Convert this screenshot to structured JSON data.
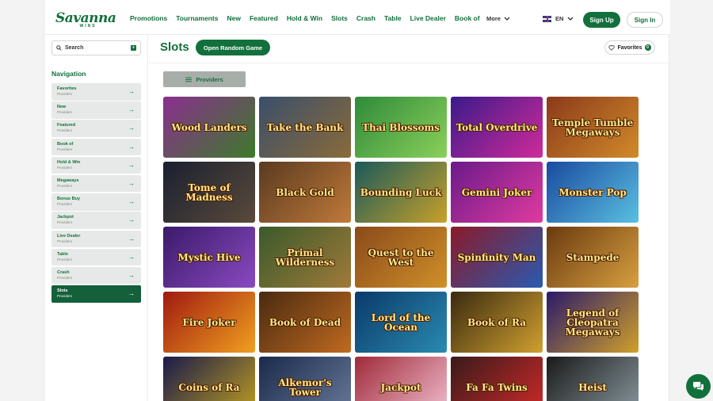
{
  "header": {
    "logo_word": "Savanna",
    "logo_sub": "WINS",
    "nav": [
      "Promotions",
      "Tournaments",
      "New",
      "Featured",
      "Hold & Win",
      "Slots",
      "Crash",
      "Table",
      "Live Dealer",
      "Book of"
    ],
    "more_label": "More",
    "lang_label": "EN",
    "signup_label": "Sign Up",
    "signin_label": "Sign In"
  },
  "sidebar": {
    "search_placeholder": "Search",
    "nav_title": "Navigation",
    "items": [
      {
        "label": "Favorites",
        "sub": "Providers"
      },
      {
        "label": "New",
        "sub": "Providers"
      },
      {
        "label": "Featured",
        "sub": "Providers"
      },
      {
        "label": "Book of",
        "sub": "Providers"
      },
      {
        "label": "Hold & Win",
        "sub": "Providers"
      },
      {
        "label": "Megaways",
        "sub": "Providers"
      },
      {
        "label": "Bonus Buy",
        "sub": "Providers"
      },
      {
        "label": "Jackpot",
        "sub": "Providers"
      },
      {
        "label": "Live Dealer",
        "sub": "Providers"
      },
      {
        "label": "Table",
        "sub": "Providers"
      },
      {
        "label": "Crash",
        "sub": "Providers"
      },
      {
        "label": "Slots",
        "sub": "Providers"
      }
    ],
    "active_item": "Slots"
  },
  "main": {
    "title": "Slots",
    "random_label": "Open Random Game",
    "favorites_label": "Favorites",
    "favorites_count": "0",
    "providers_label": "Providers",
    "games": [
      {
        "name": "Wood Landers",
        "colors": [
          "#8a2f8f",
          "#3d7a2a"
        ]
      },
      {
        "name": "Take the Bank",
        "colors": [
          "#3a4f6a",
          "#8a6a3a"
        ]
      },
      {
        "name": "Thai Blossoms",
        "colors": [
          "#2f8a3a",
          "#8ad05a"
        ]
      },
      {
        "name": "Total Overdrive",
        "colors": [
          "#3b1a8a",
          "#d02a9a"
        ]
      },
      {
        "name": "Temple Tumble Megaways",
        "colors": [
          "#8a3a1a",
          "#d28a2a"
        ]
      },
      {
        "name": "Tome of Madness",
        "colors": [
          "#1a2030",
          "#5a4a3a"
        ]
      },
      {
        "name": "Black Gold",
        "colors": [
          "#5a3a20",
          "#c07a3a"
        ]
      },
      {
        "name": "Bounding Luck",
        "colors": [
          "#1a5a5a",
          "#c8a02a"
        ]
      },
      {
        "name": "Gemini Joker",
        "colors": [
          "#6a1a8a",
          "#e03aa0"
        ]
      },
      {
        "name": "Monster Pop",
        "colors": [
          "#1a4aa0",
          "#5ac0e0"
        ]
      },
      {
        "name": "Mystic Hive",
        "colors": [
          "#3a1a6a",
          "#8a4ac0"
        ]
      },
      {
        "name": "Primal Wilderness",
        "colors": [
          "#3a5a2a",
          "#a07a3a"
        ]
      },
      {
        "name": "Quest to the West",
        "colors": [
          "#8a4a1a",
          "#d0902a"
        ]
      },
      {
        "name": "Spinfinity Man",
        "colors": [
          "#8a1a2a",
          "#2a5ab0"
        ]
      },
      {
        "name": "Stampede",
        "colors": [
          "#6a3a10",
          "#d8a040"
        ]
      },
      {
        "name": "Fire Joker",
        "colors": [
          "#a01a10",
          "#f0a020"
        ]
      },
      {
        "name": "Book of Dead",
        "colors": [
          "#4a2a10",
          "#c06a20"
        ]
      },
      {
        "name": "Lord of the Ocean",
        "colors": [
          "#0a3a6a",
          "#2a8ab0"
        ]
      },
      {
        "name": "Book of Ra",
        "colors": [
          "#3a2a10",
          "#d0a030"
        ]
      },
      {
        "name": "Legend of Cleopatra Megaways",
        "colors": [
          "#2a1a6a",
          "#d0a02a"
        ]
      },
      {
        "name": "Coins of Ra",
        "colors": [
          "#1a1a4a",
          "#c0a020"
        ]
      },
      {
        "name": "Alkemor's Tower",
        "colors": [
          "#1a2a4a",
          "#6a7a9a"
        ]
      },
      {
        "name": "Jackpot",
        "colors": [
          "#a02a3a",
          "#f0c0d0"
        ]
      },
      {
        "name": "Fa Fa Twins",
        "colors": [
          "#3a1a1a",
          "#d02a2a"
        ]
      },
      {
        "name": "Heist",
        "colors": [
          "#1a1a1a",
          "#8a9aa0"
        ]
      }
    ]
  },
  "colors": {
    "brand": "#12703c",
    "active_bg": "#13603a",
    "providers_bg": "#a7aea9"
  }
}
